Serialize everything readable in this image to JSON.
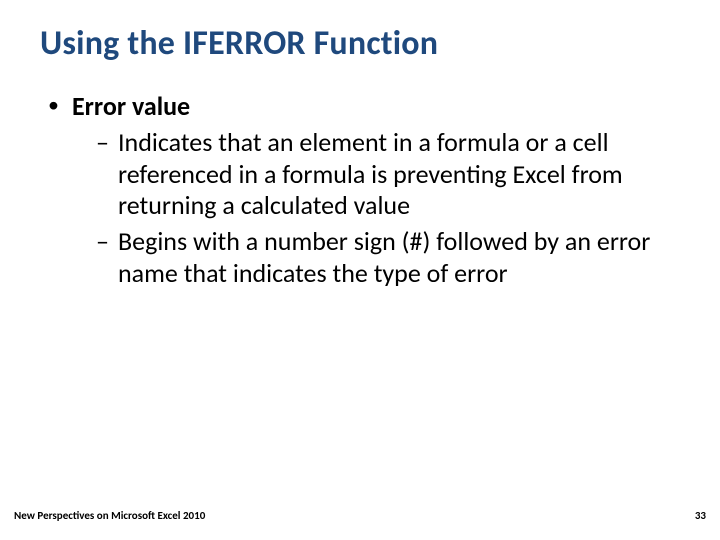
{
  "title": "Using the IFERROR Function",
  "bullets": {
    "l1": "Error value",
    "l2a": "Indicates that an element in a formula or a cell referenced in a formula is preventing Excel from returning a calculated value",
    "l2b": "Begins with a number sign (#) followed by an error name that indicates the type of error"
  },
  "footer": {
    "left": "New Perspectives on Microsoft Excel 2010",
    "page": "33"
  }
}
